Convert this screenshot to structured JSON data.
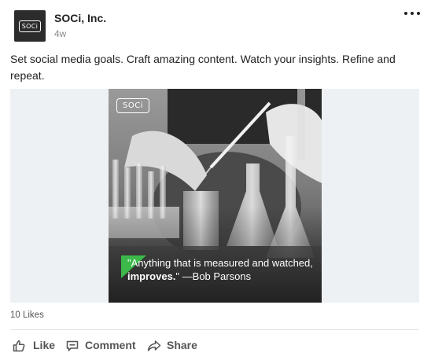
{
  "post": {
    "author": "SOCi, Inc.",
    "time": "4w",
    "avatar_logo_text": "SOCi",
    "text": "Set social media goals. Craft amazing content. Watch your insights. Refine and repeat.",
    "image": {
      "logo_text": "SOCi",
      "quote_part1": "\"Anything that is measured and watched, ",
      "quote_bold": "improves.",
      "quote_part2": "\" —Bob Parsons",
      "accent_color": "#3cb94a"
    },
    "likes": "10 Likes"
  },
  "actions": {
    "like": "Like",
    "comment": "Comment",
    "share": "Share"
  },
  "icons": {
    "more": "more-horizontal-icon",
    "like": "thumbs-up-icon",
    "comment": "comment-icon",
    "share": "share-arrow-icon"
  }
}
